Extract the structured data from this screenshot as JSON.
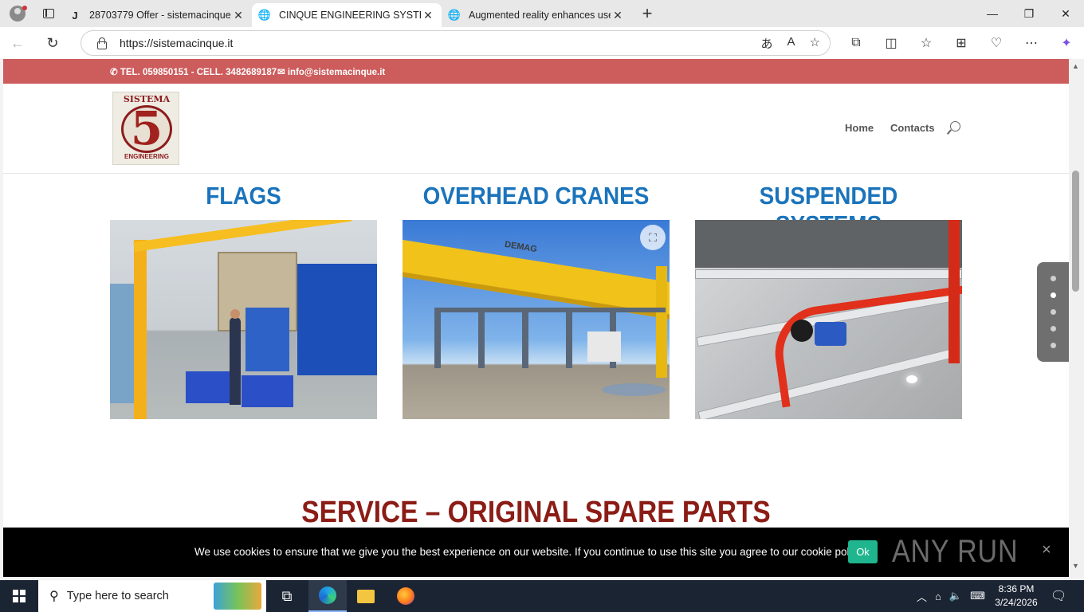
{
  "browser": {
    "tabs": [
      {
        "title": "28703779 Offer - sistemacinque-it",
        "favicon": "J",
        "active": false
      },
      {
        "title": "CINQUE ENGINEERING SYSTEM | S",
        "favicon": "globe-icon",
        "active": true
      },
      {
        "title": "Augmented reality enhances user",
        "favicon": "globe-icon",
        "active": false
      }
    ],
    "url": "https://sistemacinque.it",
    "new_tab_label": "+"
  },
  "site": {
    "topbar": {
      "phone": "TEL. 059850151 - CELL. 3482689187",
      "email": "info@sistemacinque.it"
    },
    "logo": {
      "top_text": "SISTEMA",
      "number": "5",
      "bottom_text": "ENGINEERING"
    },
    "menu": {
      "home": "Home",
      "contacts": "Contacts"
    },
    "columns": [
      {
        "title": "FLAGS"
      },
      {
        "title": "OVERHEAD CRANES",
        "brand_on_beam": "DEMAG"
      },
      {
        "title": "SUSPENDED SYSTEMS"
      }
    ],
    "service_heading": "SERVICE – ORIGINAL SPARE PARTS",
    "cookie": {
      "message": "We use cookies to ensure that we give you the best experience on our website. If you continue to use this site you agree to our cookie policy.",
      "ok_label": "Ok",
      "close_label": "×"
    },
    "watermark": "ANY RUN",
    "slider_dots": 5,
    "slider_active_index": 1
  },
  "taskbar": {
    "search_placeholder": "Type here to search",
    "time": "8:36 PM",
    "date": "3/24/2026"
  },
  "colors": {
    "topbar": "#cd5c5c",
    "column_title": "#1b74bb",
    "service_heading": "#8b1c16",
    "cookie_ok": "#1fb58e"
  }
}
